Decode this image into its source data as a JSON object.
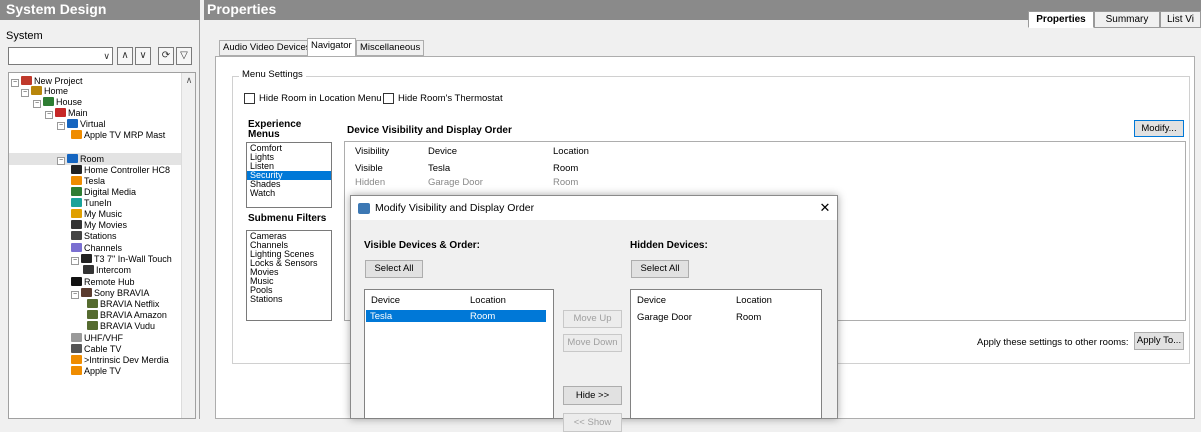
{
  "left": {
    "title": "System Design",
    "system_label": "System",
    "tree": [
      {
        "label": "New Project",
        "icon": "project-icon",
        "color": "#c0392b",
        "indent": 0,
        "expander": "−"
      },
      {
        "label": "Home",
        "icon": "home-icon",
        "color": "#b8860b",
        "indent": 1,
        "expander": "−"
      },
      {
        "label": "House",
        "icon": "house-icon",
        "color": "#2e7d32",
        "indent": 2,
        "expander": "−"
      },
      {
        "label": "Main",
        "icon": "floor-icon",
        "color": "#c62828",
        "indent": 3,
        "expander": "−"
      },
      {
        "label": "Virtual",
        "icon": "room-icon",
        "color": "#1565c0",
        "indent": 4,
        "expander": "−"
      },
      {
        "label": "Apple TV MRP Mast",
        "icon": "driver-icon",
        "color": "#ef8c00",
        "indent": 5,
        "expander": ""
      },
      {
        "label": "Room",
        "icon": "room-icon",
        "color": "#1565c0",
        "indent": 4,
        "expander": "−",
        "selected": true
      },
      {
        "label": "Home Controller HC8",
        "icon": "controller-icon",
        "color": "#222222",
        "indent": 5,
        "expander": ""
      },
      {
        "label": "Tesla",
        "icon": "driver-icon",
        "color": "#ef8c00",
        "indent": 5,
        "expander": ""
      },
      {
        "label": "Digital Media",
        "icon": "media-icon",
        "color": "#2e7d32",
        "indent": 5,
        "expander": ""
      },
      {
        "label": "TuneIn",
        "icon": "tunein-icon",
        "color": "#1aa39a",
        "indent": 5,
        "expander": ""
      },
      {
        "label": "My Music",
        "icon": "music-icon",
        "color": "#e0a000",
        "indent": 5,
        "expander": ""
      },
      {
        "label": "My Movies",
        "icon": "movies-icon",
        "color": "#333333",
        "indent": 5,
        "expander": ""
      },
      {
        "label": "Stations",
        "icon": "stations-icon",
        "color": "#444444",
        "indent": 5,
        "expander": ""
      },
      {
        "label": "Channels",
        "icon": "channels-icon",
        "color": "#7a6fd1",
        "indent": 5,
        "expander": ""
      },
      {
        "label": "T3 7\" In-Wall Touch",
        "icon": "touchscreen-icon",
        "color": "#222222",
        "indent": 5,
        "expander": "−"
      },
      {
        "label": "Intercom",
        "icon": "intercom-icon",
        "color": "#333333",
        "indent": 6,
        "expander": ""
      },
      {
        "label": "Remote Hub",
        "icon": "remote-icon",
        "color": "#111111",
        "indent": 5,
        "expander": ""
      },
      {
        "label": "Sony BRAVIA",
        "icon": "tv-icon",
        "color": "#5a3b2e",
        "indent": 5,
        "expander": "−"
      },
      {
        "label": "BRAVIA Netflix",
        "icon": "app-icon",
        "color": "#556b2f",
        "indent": 6,
        "expander": ""
      },
      {
        "label": "BRAVIA Amazon",
        "icon": "app-icon",
        "color": "#556b2f",
        "indent": 6,
        "expander": ""
      },
      {
        "label": "BRAVIA Vudu",
        "icon": "app-icon",
        "color": "#556b2f",
        "indent": 6,
        "expander": ""
      },
      {
        "label": "UHF/VHF",
        "icon": "antenna-icon",
        "color": "#999999",
        "indent": 5,
        "expander": ""
      },
      {
        "label": "Cable TV",
        "icon": "cable-icon",
        "color": "#555555",
        "indent": 5,
        "expander": ""
      },
      {
        "label": ">Intrinsic Dev Merdia",
        "icon": "driver-icon",
        "color": "#ef8c00",
        "indent": 5,
        "expander": ""
      },
      {
        "label": "Apple TV",
        "icon": "driver-icon",
        "color": "#ef8c00",
        "indent": 5,
        "expander": ""
      }
    ]
  },
  "right": {
    "title": "Properties",
    "top_tabs": [
      "Properties",
      "Summary",
      "List Vi"
    ],
    "sub_tabs": [
      "Audio Video Devices",
      "Navigator",
      "Miscellaneous"
    ],
    "menu_settings": {
      "group_label": "Menu Settings",
      "hide_room_label": "Hide Room in Location Menu",
      "hide_thermostat_label": "Hide Room's Thermostat",
      "hide_room_checked": false,
      "hide_thermostat_checked": false
    },
    "experience_menus": {
      "label_line1": "Experience",
      "label_line2": "Menus",
      "items": [
        "Comfort",
        "Lights",
        "Listen",
        "Security",
        "Shades",
        "Watch"
      ],
      "selected": "Security"
    },
    "submenu_filters": {
      "label": "Submenu Filters",
      "items": [
        "Cameras",
        "Channels",
        "Lighting Scenes",
        "Locks & Sensors",
        "Movies",
        "Music",
        "Pools",
        "Stations"
      ]
    },
    "device_visibility": {
      "label": "Device Visibility and Display Order",
      "modify_label": "Modify...",
      "headers": [
        "Visibility",
        "Device",
        "Location"
      ],
      "rows": [
        {
          "visibility": "Visible",
          "device": "Tesla",
          "location": "Room"
        },
        {
          "visibility": "Hidden",
          "device": "Garage Door",
          "location": "Room"
        }
      ]
    },
    "apply": {
      "label": "Apply these settings to other rooms:",
      "button": "Apply To..."
    }
  },
  "dialog": {
    "title": "Modify Visibility and Display Order",
    "close": "✕",
    "visible_label": "Visible Devices & Order:",
    "hidden_label": "Hidden Devices:",
    "select_all": "Select All",
    "headers": [
      "Device",
      "Location"
    ],
    "visible_rows": [
      {
        "device": "Tesla",
        "location": "Room"
      }
    ],
    "hidden_rows": [
      {
        "device": "Garage Door",
        "location": "Room"
      }
    ],
    "move_up": "Move Up",
    "move_down": "Move Down",
    "hide": "Hide >>",
    "show": "<< Show"
  }
}
